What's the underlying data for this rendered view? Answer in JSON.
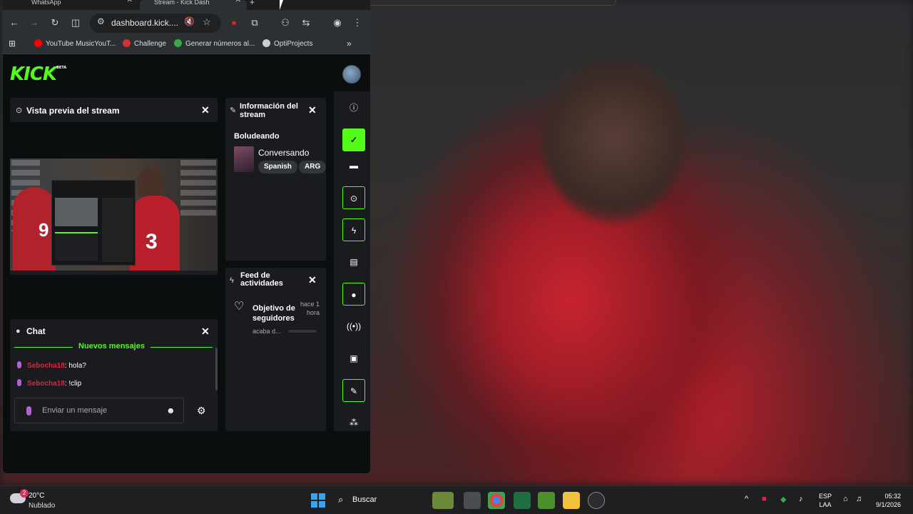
{
  "browser": {
    "tabs": [
      {
        "label": "WhatsApp"
      },
      {
        "label": "Stream - Kick Dash"
      }
    ],
    "url": "dashboard.kick....",
    "bookmarks": [
      {
        "label": "YouTube MusicYouT...",
        "color": "#ff0000"
      },
      {
        "label": "Challenge",
        "color": "#d13232"
      },
      {
        "label": "Generar números al...",
        "color": "#3aa845"
      },
      {
        "label": "OptiProjects",
        "color": "#cccccc"
      }
    ]
  },
  "kick": {
    "logo": "KICK",
    "logo_badge": "BETA",
    "accent": "#53fc18",
    "preview": {
      "title": "Vista previa del stream"
    },
    "info": {
      "title": "Información del stream",
      "stream_title": "Boludeando",
      "category": "Conversando",
      "tags": [
        "Spanish",
        "ARG"
      ]
    },
    "feed": {
      "title": "Feed de actividades",
      "item_title": "Objetivo de seguidores",
      "item_time": "hace 1 hora",
      "item_desc": "acaba d..."
    },
    "chat": {
      "title": "Chat",
      "new_messages": "Nuevos mensajes",
      "messages": [
        {
          "user": "Sebocha18",
          "text": ": hola?"
        },
        {
          "user": "Sebocha18",
          "text": ": !clip"
        }
      ],
      "input_placeholder": "Enviar un mensaje"
    }
  },
  "taskbar": {
    "weather_temp": "20°C",
    "weather_cond": "Nublado",
    "weather_badge": "2",
    "search_label": "Buscar",
    "lang_1": "ESP",
    "lang_2": "LAA",
    "time": "05:32",
    "date": "9/1/2026"
  }
}
